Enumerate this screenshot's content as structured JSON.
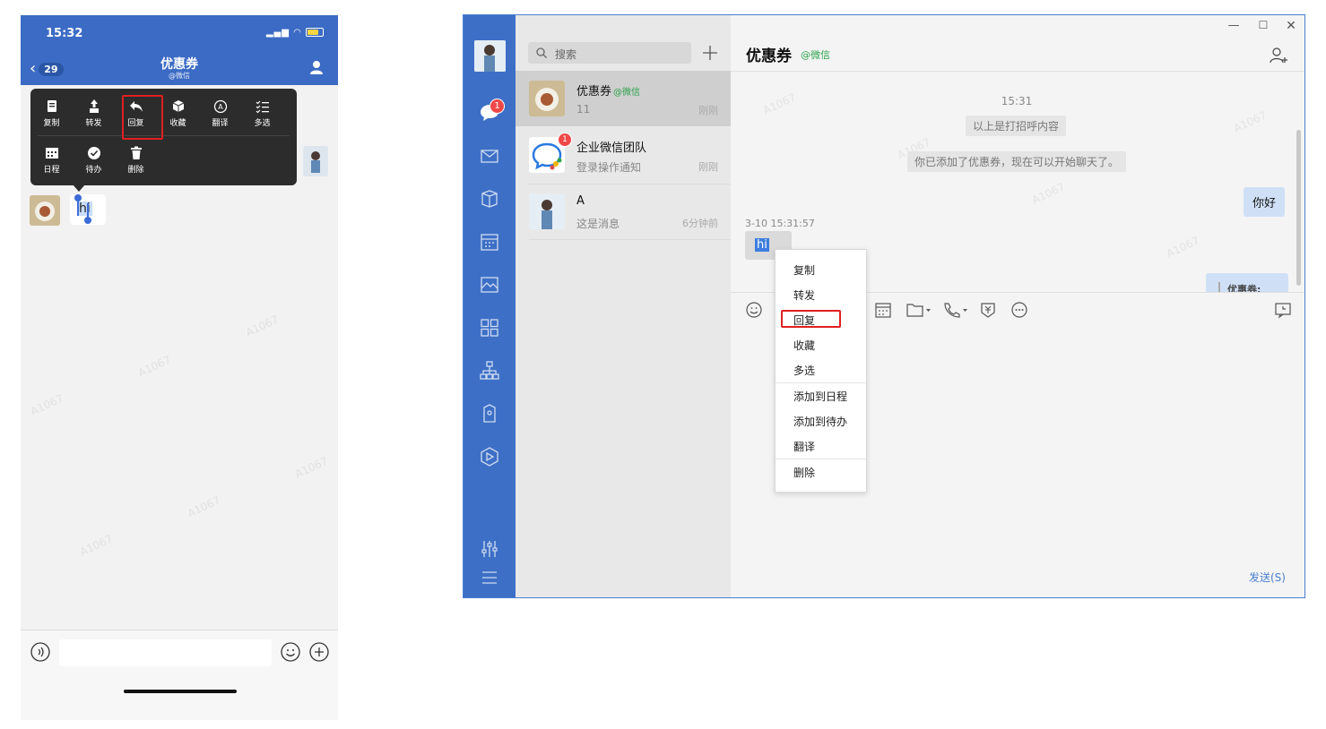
{
  "phone": {
    "status_time": "15:32",
    "back_count": "29",
    "title": "优惠券",
    "subtitle": "@微信",
    "menu_row1": [
      "复制",
      "转发",
      "回复",
      "收藏",
      "翻译",
      "多选"
    ],
    "menu_row2": [
      "日程",
      "待办",
      "删除"
    ],
    "message_text": "hi",
    "watermark": "A1067"
  },
  "desktop": {
    "search_placeholder": "搜索",
    "conversations": [
      {
        "name": "优惠券",
        "tag": "@微信",
        "preview": "11",
        "time": "刚刚",
        "badge": ""
      },
      {
        "name": "企业微信团队",
        "tag": "",
        "preview": "登录操作通知",
        "time": "刚刚",
        "badge": "1"
      },
      {
        "name": "A",
        "tag": "",
        "preview": "这是消息",
        "time": "6分钟前",
        "badge": ""
      }
    ],
    "chat_badge": "1",
    "chat_title": "优惠券",
    "chat_tag": "@微信",
    "window_controls": {
      "min": "—",
      "max": "☐",
      "close": "✕"
    },
    "messages": {
      "sys_time": "15:31",
      "sys_line1": "以上是打招呼内容",
      "sys_line2": "你已添加了优惠券，现在可以开始聊天了。",
      "outgoing": "你好",
      "incoming_time": "3-10 15:31:57",
      "incoming": "hi",
      "quote_label": "优惠券:"
    },
    "send_label": "发送(S)",
    "watermark": "A1067"
  },
  "context_menu": {
    "items": [
      "复制",
      "转发",
      "回复",
      "收藏",
      "多选",
      "添加到日程",
      "添加到待办",
      "翻译",
      "删除"
    ]
  },
  "colors": {
    "brand_blue": "#3d6fc6",
    "highlight_red": "#e02020",
    "wechat_green": "#2ba24c",
    "badge_red": "#f04848"
  }
}
